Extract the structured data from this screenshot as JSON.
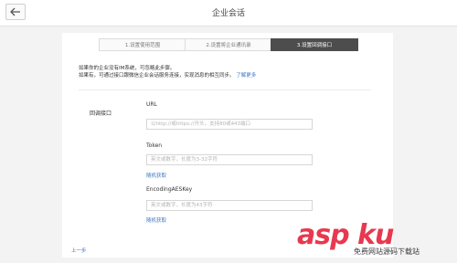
{
  "header": {
    "title": "企业会话",
    "back_icon": "arrow-left-icon"
  },
  "steps": [
    {
      "label": "1.设置使用范围",
      "active": false
    },
    {
      "label": "2.设置将企业通讯录",
      "active": false
    },
    {
      "label": "3.设置回调接口",
      "active": true
    }
  ],
  "notes": {
    "line1": "如果你的企业没有IM系统，可忽略此步骤。",
    "line2": "如果有，可通过接口跟微信企业会话服务连接，实现消息的相互同步。",
    "learn_more": "了解更多"
  },
  "form": {
    "section_label": "回调接口",
    "url": {
      "label": "URL",
      "placeholder": "以http://或https://开头，支持80或443端口",
      "value": ""
    },
    "token": {
      "label": "Token",
      "placeholder": "英文或数字，长度为3-32字符",
      "value": "",
      "random_link": "随机获取"
    },
    "aes": {
      "label": "EncodingAESKey",
      "placeholder": "英文或数字，长度为43字符",
      "value": "",
      "random_link": "随机获取"
    }
  },
  "footer": {
    "prev_link": "上一步"
  },
  "watermark": {
    "main": "asp ku",
    "sub": "免费网站源码下载站"
  },
  "colors": {
    "accent": "#3b76c4",
    "active_step": "#4d4d4d",
    "watermark": "#e8384f"
  }
}
